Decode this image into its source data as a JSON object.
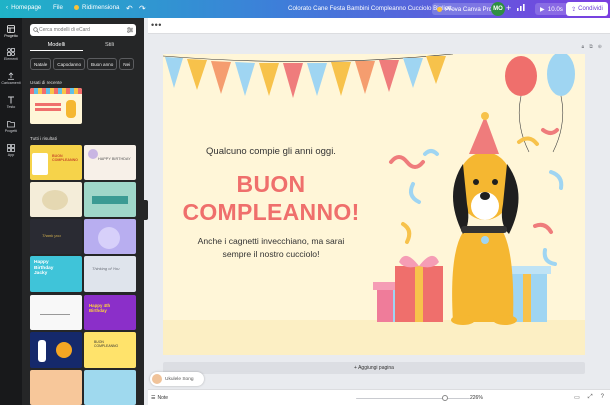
{
  "topbar": {
    "home": "Homepage",
    "file": "File",
    "resize": "Ridimensiona",
    "title": "Colorato Cane Festa Bambini Compleanno Cucciolo Bigliett...",
    "pro": "Prova Canva Pro",
    "avatar_initials": "MO",
    "timer": "10.0s",
    "share": "Condividi",
    "colors": {
      "gradient_start": "#1fb3c7",
      "gradient_end": "#7b3fe0"
    }
  },
  "rail": {
    "items": [
      {
        "label": "Progetto",
        "icon": "layout-icon"
      },
      {
        "label": "Elementi",
        "icon": "shapes-icon"
      },
      {
        "label": "Caricamenti",
        "icon": "upload-icon"
      },
      {
        "label": "Testo",
        "icon": "text-icon"
      },
      {
        "label": "Progetti",
        "icon": "folder-icon"
      },
      {
        "label": "App",
        "icon": "apps-icon"
      }
    ]
  },
  "panel": {
    "search_placeholder": "Cerca modelli di eCard",
    "tabs": [
      "Modelli",
      "Stili"
    ],
    "chips": [
      "Natale",
      "Capodanno",
      "Buon anno",
      "Nei"
    ],
    "recent_label": "Usati di recente",
    "all_label": "Tutti i risultati",
    "thumb_texts": {
      "t1": "BUON COMPLEANNO",
      "t2": "HAPPY BIRTHDAY",
      "t3": "Thank you",
      "t4": "Happy Birthday Jacky",
      "t5": "Thinking of You",
      "t6": "Happy 4th Birthday",
      "t7": "BUON COMPLEANNO"
    }
  },
  "canvas": {
    "message_top": "Qualcuno compie gli anni oggi.",
    "headline_line1": "BUON",
    "headline_line2": "COMPLEANNO!",
    "message_bottom_line1": "Anche i cagnetti invecchiano, ma sarai",
    "message_bottom_line2": "sempre il nostro cucciolo!",
    "colors": {
      "background": "#fff6d8",
      "headline": "#ef6f6c",
      "dog": "#f5b731"
    }
  },
  "workspace": {
    "add_page": "+ Aggiungi pagina",
    "tooltip_name": "Ukulele Song",
    "notes": "Note",
    "zoom": "226%",
    "zoom_fraction": 0.8
  }
}
